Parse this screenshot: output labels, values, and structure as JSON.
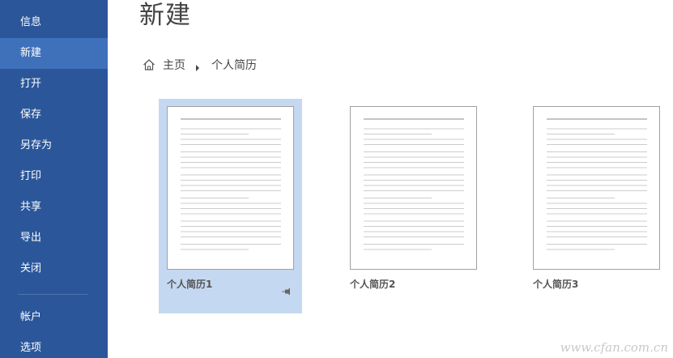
{
  "sidebar": {
    "items": [
      {
        "label": "信息"
      },
      {
        "label": "新建"
      },
      {
        "label": "打开"
      },
      {
        "label": "保存"
      },
      {
        "label": "另存为"
      },
      {
        "label": "打印"
      },
      {
        "label": "共享"
      },
      {
        "label": "导出"
      },
      {
        "label": "关闭"
      },
      {
        "label": "帐户"
      },
      {
        "label": "选项"
      }
    ],
    "active_item": "新建"
  },
  "main": {
    "title": "新建",
    "breadcrumb": {
      "home": "主页",
      "current": "个人简历"
    },
    "templates": [
      {
        "label": "个人简历1",
        "selected": true
      },
      {
        "label": "个人简历2",
        "selected": false
      },
      {
        "label": "个人简历3",
        "selected": false
      }
    ]
  },
  "colors": {
    "sidebar": "#2b579a",
    "sidebar_active": "#3f71bb",
    "selected_card": "#c5d8f1"
  },
  "watermark": "www.cfan.com.cn"
}
